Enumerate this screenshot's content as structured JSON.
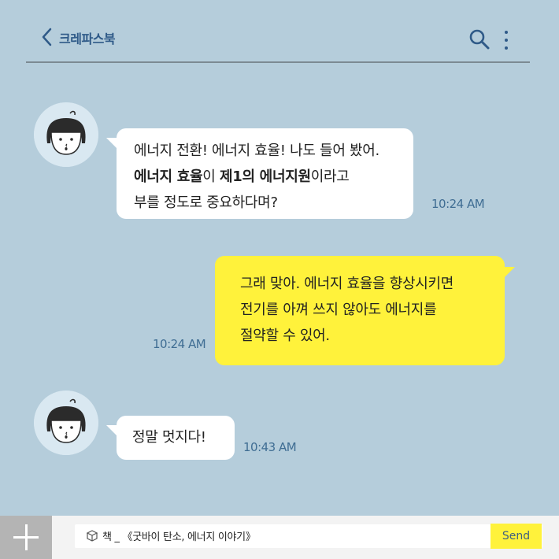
{
  "header": {
    "title": "크레파스북"
  },
  "messages": [
    {
      "sender": "friend",
      "line1": "에너지 전환! 에너지 효율! 나도 들어 봤어.",
      "line2_bold1": "에너지 효율",
      "line2_mid": "이 ",
      "line2_bold2": "제1의 에너지원",
      "line2_end": "이라고",
      "line3": "부를 정도로 중요하다며?",
      "time": "10:24 AM"
    },
    {
      "sender": "me",
      "line1": "그래 맞아. 에너지 효율을 향상시키면",
      "line2": "전기를 아껴 쓰지 않아도 에너지를",
      "line3": "절약할 수 있어.",
      "time": "10:24 AM"
    },
    {
      "sender": "friend",
      "line1": "정말 멋지다!",
      "time": "10:43 AM"
    }
  ],
  "input": {
    "value": "책 _ 《굿바이 탄소, 에너지 이야기》",
    "send_label": "Send"
  },
  "colors": {
    "background": "#b5cddb",
    "accent": "#2f5a88",
    "my_bubble": "#fff23b",
    "friend_bubble": "#ffffff"
  }
}
